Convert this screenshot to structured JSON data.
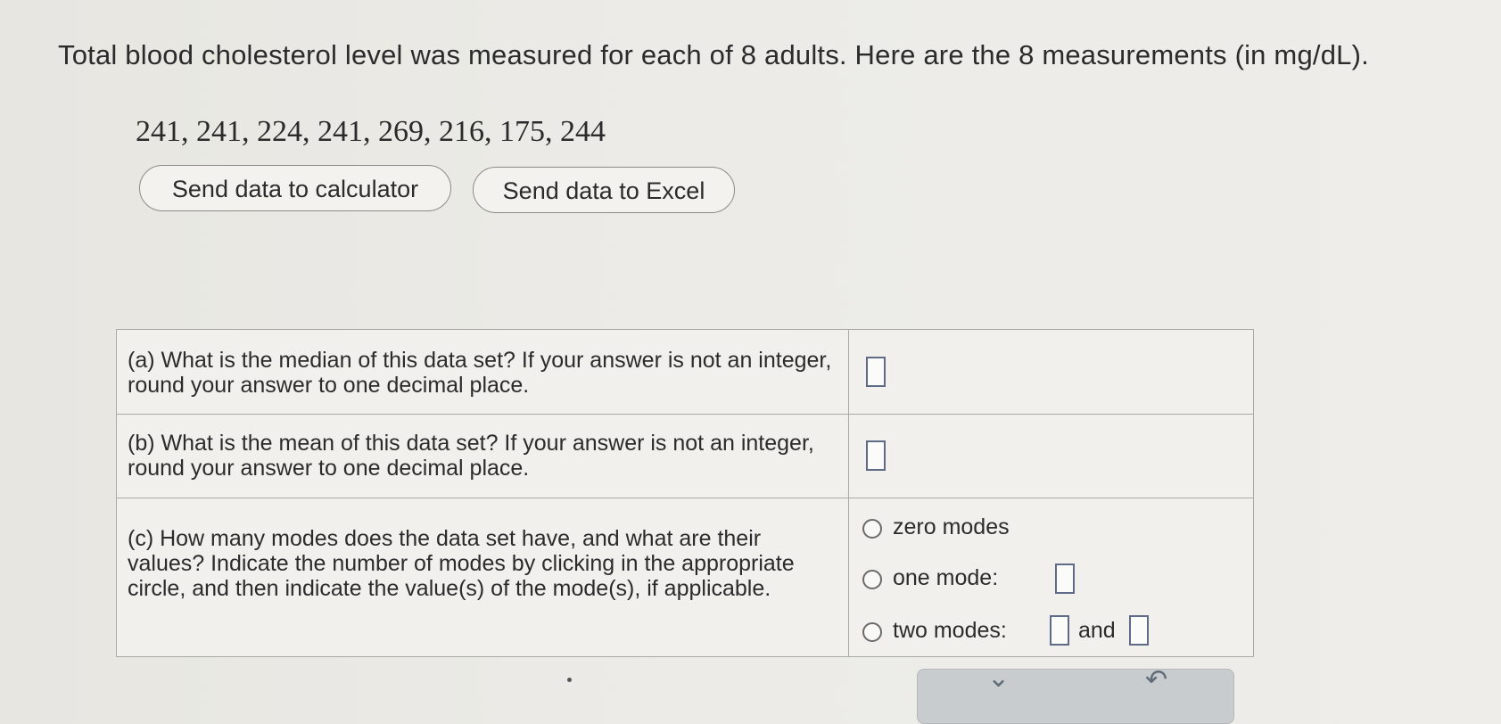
{
  "problem": {
    "intro": "Total blood cholesterol level was measured for each of 8 adults. Here are the 8 measurements (in mg/dL).",
    "data_values": "241, 241, 224, 241, 269, 216, 175, 244"
  },
  "buttons": {
    "calculator": "Send data to calculator",
    "excel": "Send data to Excel"
  },
  "questions": {
    "a": "(a) What is the median of this data set? If your answer is not an integer, round your answer to one decimal place.",
    "b": "(b) What is the mean of this data set? If your answer is not an integer, round your answer to one decimal place.",
    "c": "(c) How many modes does the data set have, and what are their values? Indicate the number of modes by clicking in the appropriate circle, and then indicate the value(s) of the mode(s), if applicable."
  },
  "mode_options": {
    "zero": "zero modes",
    "one": "one mode:",
    "two": "two modes:",
    "and": "and"
  },
  "footer": {
    "chevron_down": "⌄",
    "undo": "↶"
  }
}
